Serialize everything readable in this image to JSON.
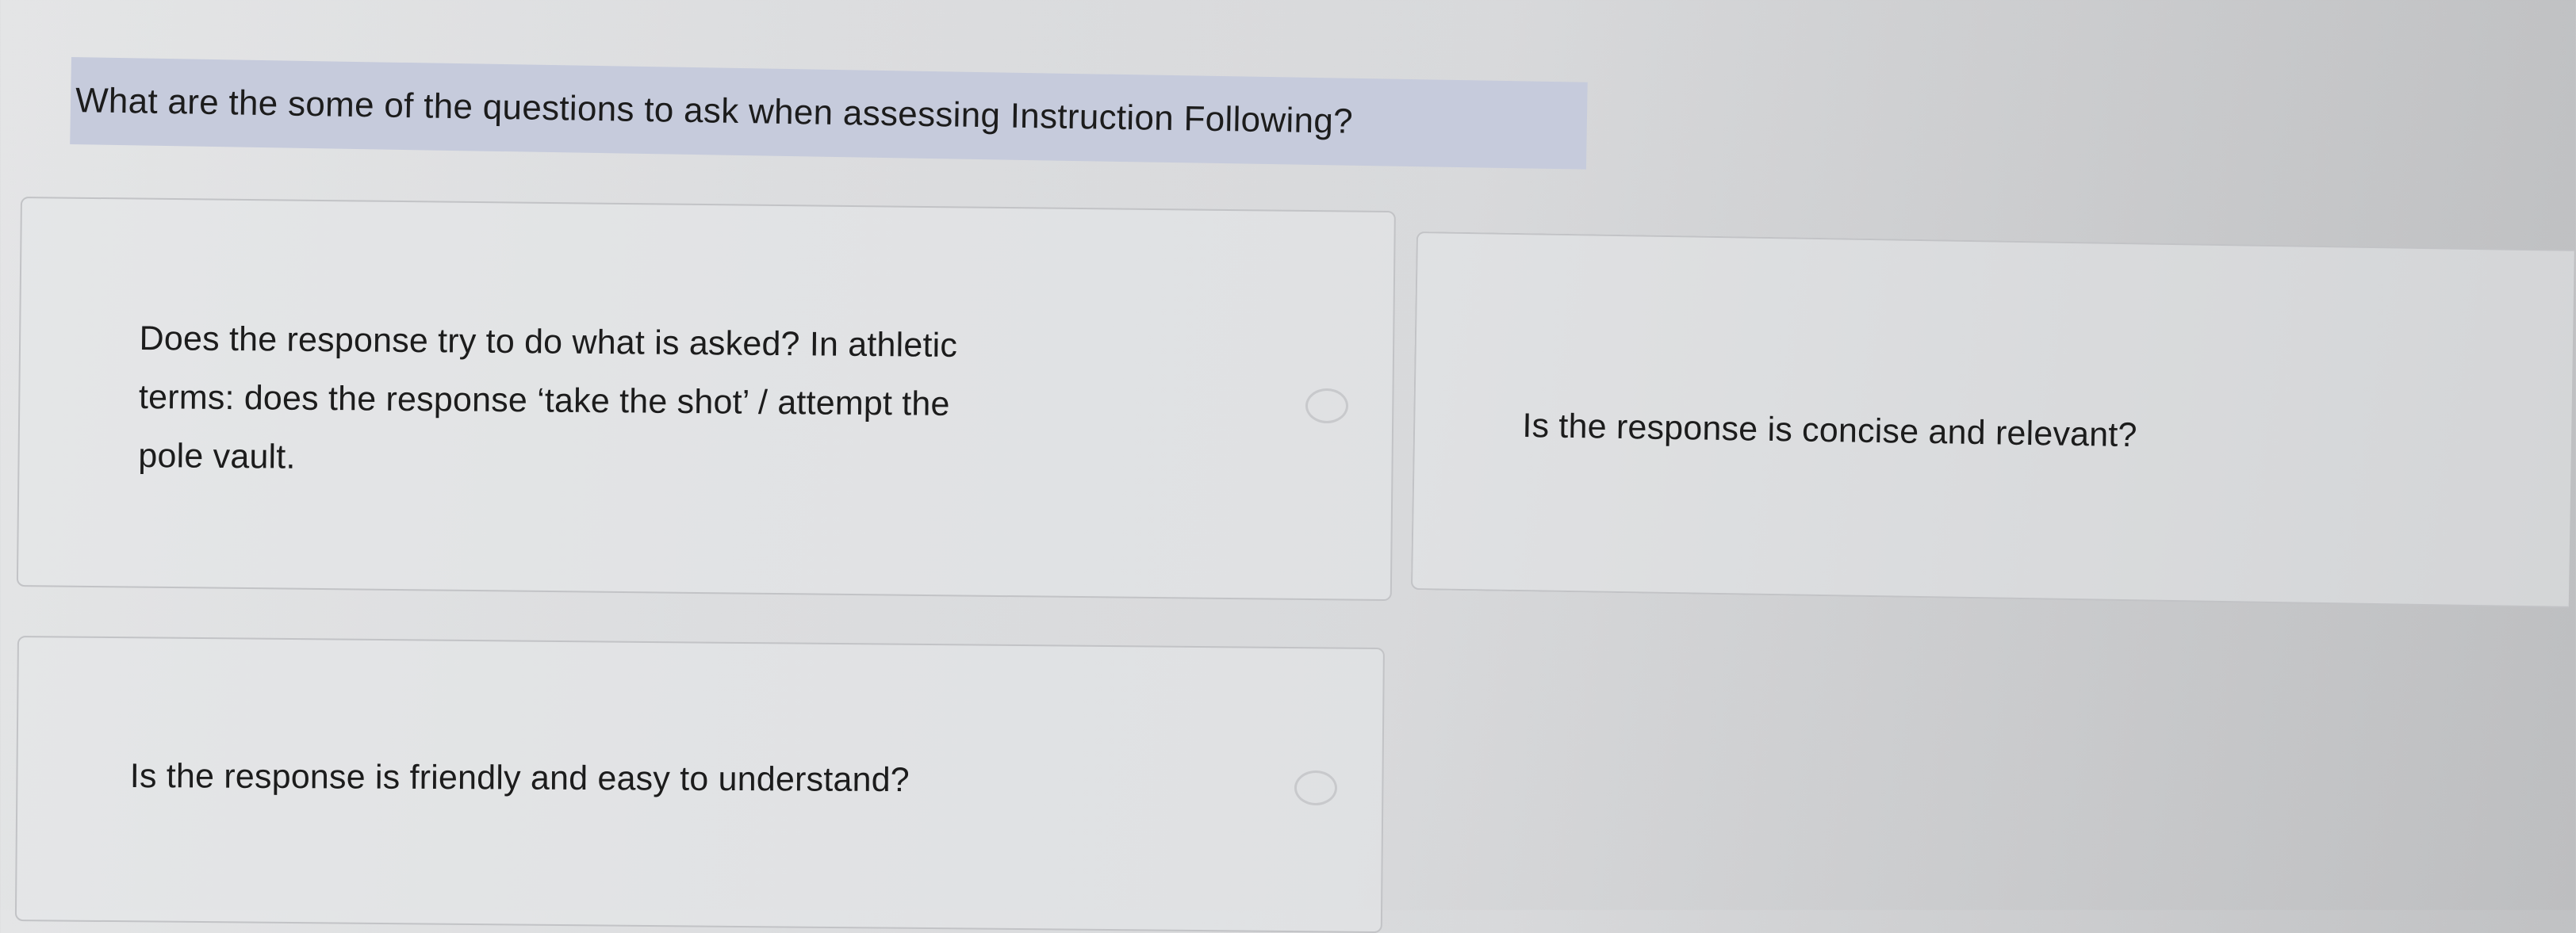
{
  "question": {
    "text": "What are the some of the questions to ask when assessing Instruction Following?"
  },
  "options": [
    {
      "lines": [
        "Does the response try to do what is asked? In athletic",
        "terms: does the response ‘take the shot’ / attempt the",
        "pole vault."
      ]
    },
    {
      "text": "Is the response is concise and relevant?"
    },
    {
      "text": "Is the response is friendly and easy to understand?"
    }
  ]
}
